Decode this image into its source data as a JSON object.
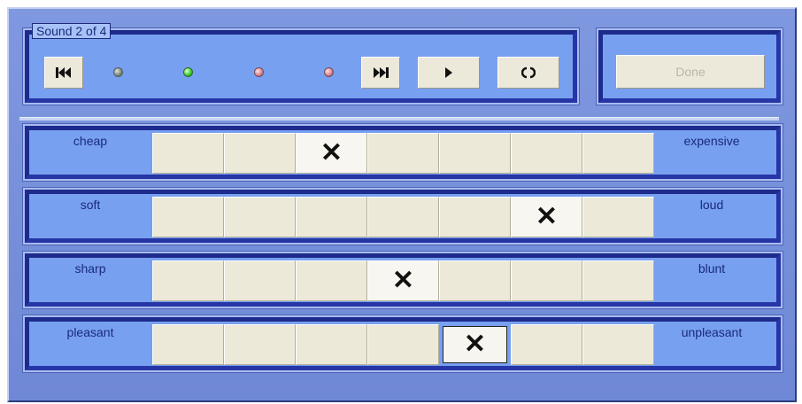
{
  "player": {
    "title": "Sound 2 of 4",
    "controls": {
      "first_icon": "skip-to-start-icon",
      "last_icon": "skip-to-end-icon",
      "play_icon": "play-icon",
      "repeat_icon": "repeat-icon"
    },
    "indicators": [
      {
        "state": "played",
        "color": "#7c8d80"
      },
      {
        "state": "current",
        "color": "#3fd02f"
      },
      {
        "state": "pending",
        "color": "#d98a96"
      },
      {
        "state": "pending",
        "color": "#d98a96"
      }
    ]
  },
  "done_button": {
    "label": "Done",
    "enabled": false
  },
  "scales": [
    {
      "left": "cheap",
      "right": "expensive",
      "selected": 3,
      "steps": 7
    },
    {
      "left": "soft",
      "right": "loud",
      "selected": 6,
      "steps": 7
    },
    {
      "left": "sharp",
      "right": "blunt",
      "selected": 4,
      "steps": 7
    },
    {
      "left": "pleasant",
      "right": "unpleasant",
      "selected": 5,
      "steps": 7
    }
  ],
  "mark_symbol": "✕"
}
